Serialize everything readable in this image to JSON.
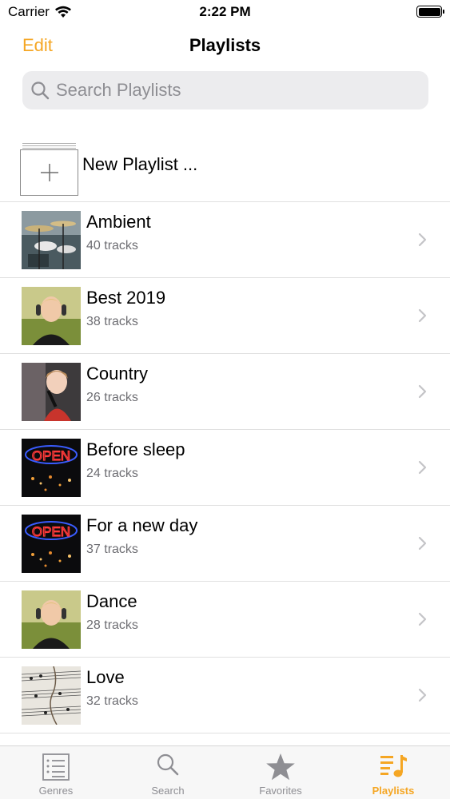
{
  "status": {
    "carrier": "Carrier",
    "time": "2:22 PM"
  },
  "nav": {
    "edit_label": "Edit",
    "title": "Playlists"
  },
  "search": {
    "placeholder": "Search Playlists",
    "value": ""
  },
  "new_playlist": {
    "label": "New Playlist ..."
  },
  "playlists": [
    {
      "title": "Ambient",
      "subtitle": "40 tracks",
      "art": "drums"
    },
    {
      "title": "Best 2019",
      "subtitle": "38 tracks",
      "art": "woman-headphones"
    },
    {
      "title": "Country",
      "subtitle": "26 tracks",
      "art": "girl-singing"
    },
    {
      "title": "Before sleep",
      "subtitle": "24 tracks",
      "art": "open-sign"
    },
    {
      "title": "For a new day",
      "subtitle": "37 tracks",
      "art": "open-sign"
    },
    {
      "title": "Dance",
      "subtitle": "28 tracks",
      "art": "woman-headphones"
    },
    {
      "title": "Love",
      "subtitle": "32 tracks",
      "art": "sheet-music"
    }
  ],
  "tabs": [
    {
      "label": "Genres",
      "icon": "list-icon",
      "active": false
    },
    {
      "label": "Search",
      "icon": "search-icon",
      "active": false
    },
    {
      "label": "Favorites",
      "icon": "star-icon",
      "active": false
    },
    {
      "label": "Playlists",
      "icon": "music-list-icon",
      "active": true
    }
  ],
  "colors": {
    "accent": "#f5a623",
    "inactive": "#8e8e93",
    "separator": "#e0e0e0"
  }
}
